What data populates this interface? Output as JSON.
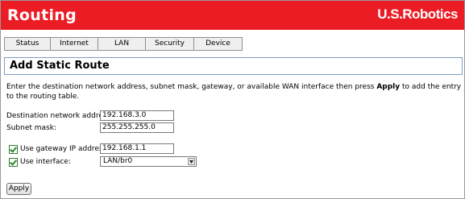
{
  "header": {
    "title": "Routing",
    "brand": "U.S.Robotics"
  },
  "nav": {
    "tabs": [
      {
        "label": "Status"
      },
      {
        "label": "Internet"
      },
      {
        "label": "LAN"
      },
      {
        "label": "Security"
      },
      {
        "label": "Device"
      }
    ]
  },
  "page": {
    "title": "Add Static Route",
    "description_before": "Enter the destination network address, subnet mask, gateway, or available WAN interface then press ",
    "description_bold": "Apply",
    "description_after": " to add the entry to the routing table."
  },
  "form": {
    "dest_label": "Destination network address:",
    "dest_value": "192.168.3.0",
    "mask_label": "Subnet mask:",
    "mask_value": "255.255.255.0",
    "gateway_checkbox_label": "Use gateway IP address:",
    "gateway_checked": true,
    "gateway_value": "192.168.1.1",
    "interface_checkbox_label": "Use interface:",
    "interface_checked": true,
    "interface_value": "LAN/br0"
  },
  "actions": {
    "apply_label": "Apply"
  },
  "colors": {
    "header_red": "#ec1c24",
    "panel_border": "#7d9cc4",
    "checkbox_green": "#2a8a2a"
  }
}
